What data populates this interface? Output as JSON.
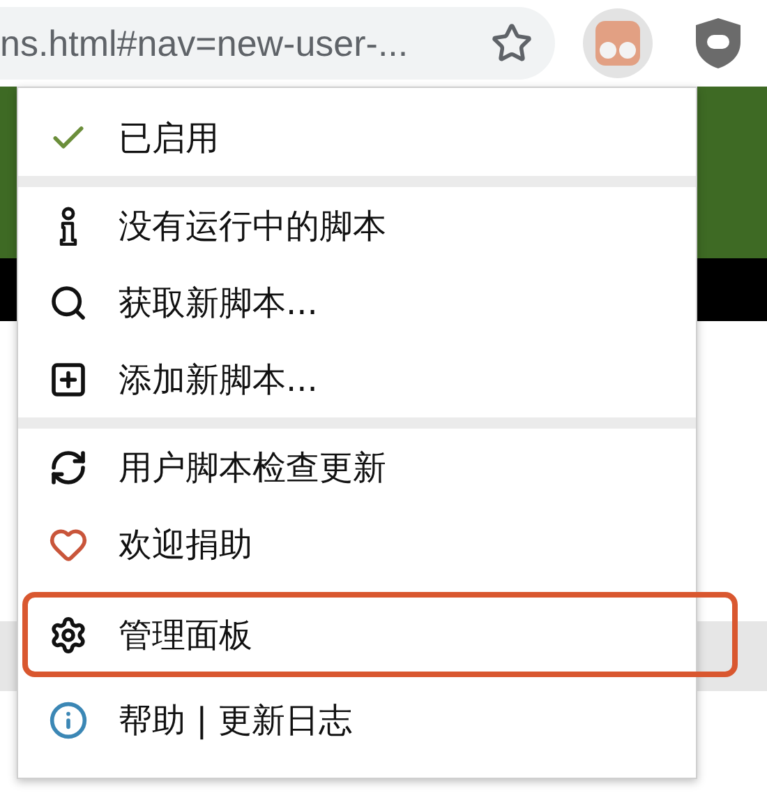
{
  "address_bar": {
    "url": "ns.html#nav=new-user-...",
    "bookmarked": false
  },
  "menu": {
    "sections": [
      {
        "items": [
          {
            "kind": "toggle",
            "label": "已启用",
            "checked": true,
            "annotated": false
          }
        ]
      },
      {
        "items": [
          {
            "kind": "status",
            "label": "没有运行中的脚本",
            "annotated": false
          },
          {
            "kind": "search",
            "label": "获取新脚本...",
            "annotated": false
          },
          {
            "kind": "add",
            "label": "添加新脚本...",
            "annotated": false
          }
        ]
      },
      {
        "items": [
          {
            "kind": "update",
            "label": "用户脚本检查更新",
            "annotated": false
          },
          {
            "kind": "donate",
            "label": "欢迎捐助",
            "annotated": false
          },
          {
            "kind": "settings",
            "label": "管理面板",
            "annotated": true
          },
          {
            "kind": "help",
            "label": "帮助 | 更新日志",
            "annotated": false
          }
        ]
      }
    ]
  }
}
